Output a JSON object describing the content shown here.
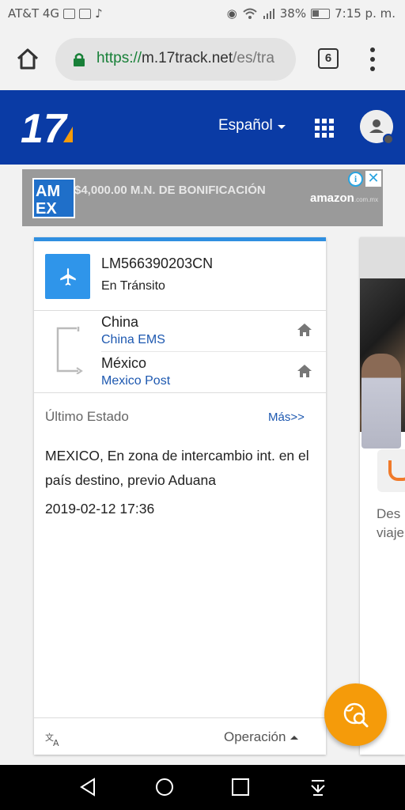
{
  "status_bar": {
    "carrier": "AT&T 4G",
    "battery": "38%",
    "time": "7:15 p. m."
  },
  "browser": {
    "url_scheme": "https://",
    "url_host": "m.17track.net",
    "url_path": "/es/tra",
    "tab_count": "6"
  },
  "header": {
    "logo": "17",
    "language": "Español",
    "icons": [
      "apps-grid-icon",
      "user-avatar-icon"
    ]
  },
  "ad": {
    "brand_line1": "AM",
    "brand_line2": "EX",
    "text": "$4,000.00 M.N. DE BONIFICACIÓN",
    "partner": "amazon",
    "partner_suffix": ".com.mx",
    "info_symbol": "i",
    "close_symbol": "✕"
  },
  "tracking": {
    "number": "LM566390203CN",
    "status": "En Tránsito",
    "origin_country": "China",
    "origin_carrier": "China EMS",
    "dest_country": "México",
    "dest_carrier": "Mexico Post",
    "last_status_label": "Último Estado",
    "more_link": "Más>>",
    "last_event": "MEXICO, En zona de intercambio int. en el país destino, previo Aduana",
    "last_event_time": "2019-02-12 17:36",
    "operation_label": "Operación",
    "accent_color": "#2f95ea"
  },
  "peek_card": {
    "text_line1": "Des",
    "text_line2": "viaje"
  },
  "colors": {
    "header_bg": "#0a3ba5",
    "fab": "#f59b0a",
    "link": "#1d58b0"
  }
}
